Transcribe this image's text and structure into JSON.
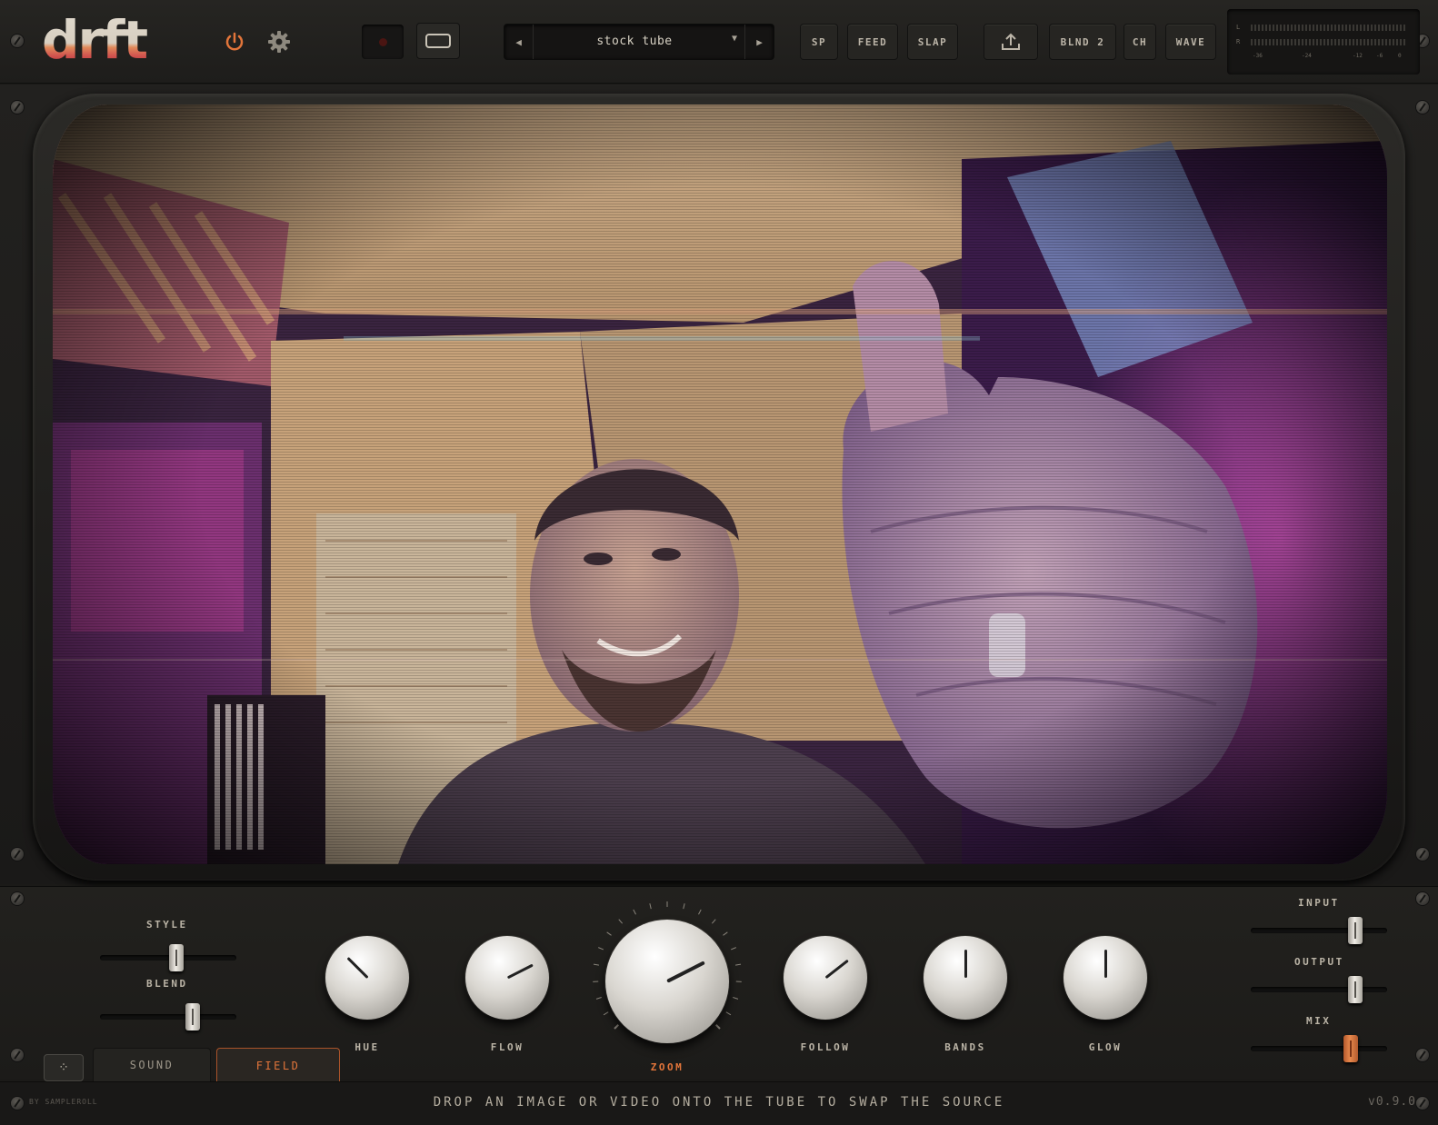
{
  "app": {
    "logo_text": "drft"
  },
  "header": {
    "power_icon": "power-icon",
    "settings_icon": "gear-icon",
    "record_icon": "record-dot-icon",
    "screen_icon": "screen-mode-icon",
    "preset": {
      "name": "stock tube",
      "prev_icon": "triangle-left-icon",
      "next_icon": "triangle-right-icon",
      "dropdown_icon": "caret-down-icon"
    },
    "buttons": {
      "sp": "SP",
      "feed": "FEED",
      "slap": "SLAP",
      "export_icon": "upload-icon",
      "blend": "BLND 2",
      "ch": "CH",
      "wave": "WAVE"
    },
    "meter": {
      "left_label": "L",
      "right_label": "R",
      "scale": [
        "-36",
        "-24",
        "-12",
        "-6",
        "0"
      ]
    }
  },
  "controls": {
    "style": {
      "label": "STYLE",
      "value": 0.57
    },
    "blend": {
      "label": "BLEND",
      "value": 0.7
    },
    "knobs": [
      {
        "id": "hue",
        "label": "HUE",
        "angle_deg": -45
      },
      {
        "id": "flow",
        "label": "FLOW",
        "angle_deg": 63
      },
      {
        "id": "zoom",
        "label": "ZOOM",
        "angle_deg": 63
      },
      {
        "id": "follow",
        "label": "FOLLOW",
        "angle_deg": 52
      },
      {
        "id": "bands",
        "label": "BANDS",
        "angle_deg": 0
      },
      {
        "id": "glow",
        "label": "GLOW",
        "angle_deg": 0
      }
    ],
    "input": {
      "label": "INPUT",
      "value": 0.8
    },
    "output": {
      "label": "OUTPUT",
      "value": 0.8
    },
    "mix": {
      "label": "MIX",
      "value": 0.76
    },
    "tabs": {
      "sound": "SOUND",
      "field": "FIELD",
      "random_icon": "dice-icon"
    }
  },
  "footer": {
    "by": "BY SAMPLEROLL",
    "hint": "DROP AN IMAGE OR VIDEO ONTO THE TUBE TO SWAP THE SOURCE",
    "version": "v0.9.0"
  },
  "colors": {
    "accent": "#e2753a",
    "panel": "#1e1d1b",
    "logo_top": "#d9d3c6",
    "logo_stripe": "#c7454a"
  }
}
